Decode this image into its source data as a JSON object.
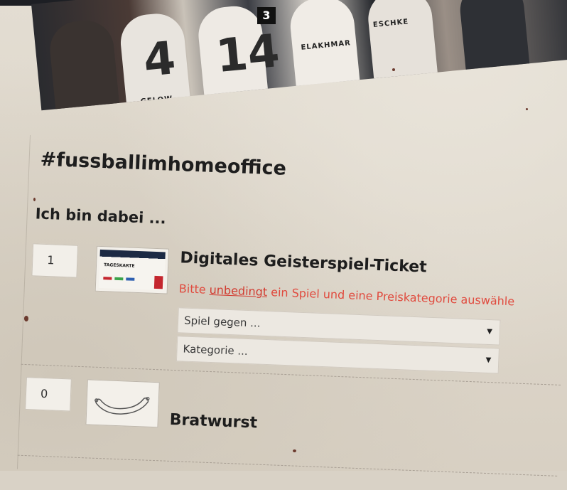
{
  "hero": {
    "badge": "3",
    "jersey_numbers": [
      "4",
      "14"
    ],
    "name_tags": [
      "ELAKHMAR",
      "ESCHKE",
      "GELOW"
    ]
  },
  "page": {
    "hashtag": "#fussballimhomeoffice",
    "subtitle": "Ich bin dabei ..."
  },
  "products": [
    {
      "quantity": "1",
      "title": "Digitales Geisterspiel-Ticket",
      "image": "ticket-image",
      "ticket_text": "TAGESKARTE",
      "warning_prefix": "Bitte ",
      "warning_emphasis": "unbedingt",
      "warning_suffix": " ein Spiel und eine Preiskategorie auswähle",
      "select_game_placeholder": "Spiel gegen ...",
      "select_category_placeholder": "Kategorie ..."
    },
    {
      "quantity": "0",
      "title": "Bratwurst",
      "image": "sausage-image"
    }
  ],
  "colors": {
    "warning": "#e04a3e",
    "text": "#1e1e1e",
    "background": "#d9d2c6"
  }
}
